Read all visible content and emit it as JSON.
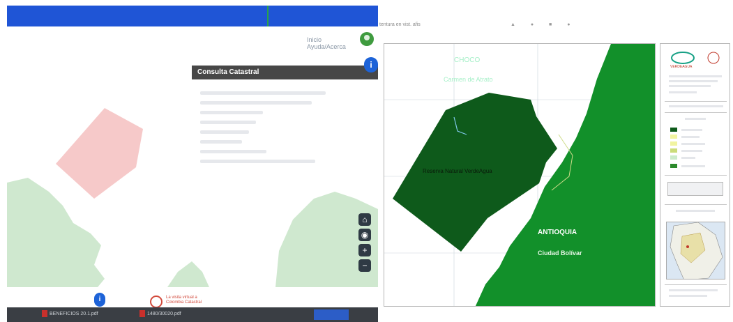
{
  "left_app": {
    "nav_links": [
      "Inicio",
      "Ayuda/Acerca"
    ],
    "panel": {
      "title": "Consulta Catastral",
      "rows": 8
    },
    "info_button": "i",
    "zoom_controls": [
      "⌂",
      "◉",
      "+",
      "−"
    ],
    "seal_caption": [
      "La visita virtual a",
      "Colombia Catastral"
    ],
    "taskbar": {
      "items": [
        "BENEFICIOS 20.1.pdf",
        "1480/30020.pdf"
      ]
    },
    "colors": {
      "topbar": "#1f55d6",
      "forest": "#cfe8cf",
      "parcel": "#f6c9c9"
    }
  },
  "right_doc": {
    "header_text": "tentura en vist. afis",
    "map": {
      "labels": {
        "choco": "CHOCO",
        "carmen": "Carmen de Atrato",
        "reserve": "Reserva Natural VerdeAgua",
        "antioquia": "ANTIOQUIA",
        "bolivar": "Ciudad Bolívar"
      },
      "colors": {
        "reserve": "#0e5a1b",
        "antioquia": "#12902a",
        "label_light": "#a6f0c8"
      }
    },
    "legend": {
      "logo_caption": "VERDEAGUA",
      "swatches": [
        "#0e5a1b",
        "#f1f4a0",
        "#f1f4a0",
        "#cbdc7a",
        "#ccebcb",
        "#2c8a2c"
      ]
    }
  }
}
